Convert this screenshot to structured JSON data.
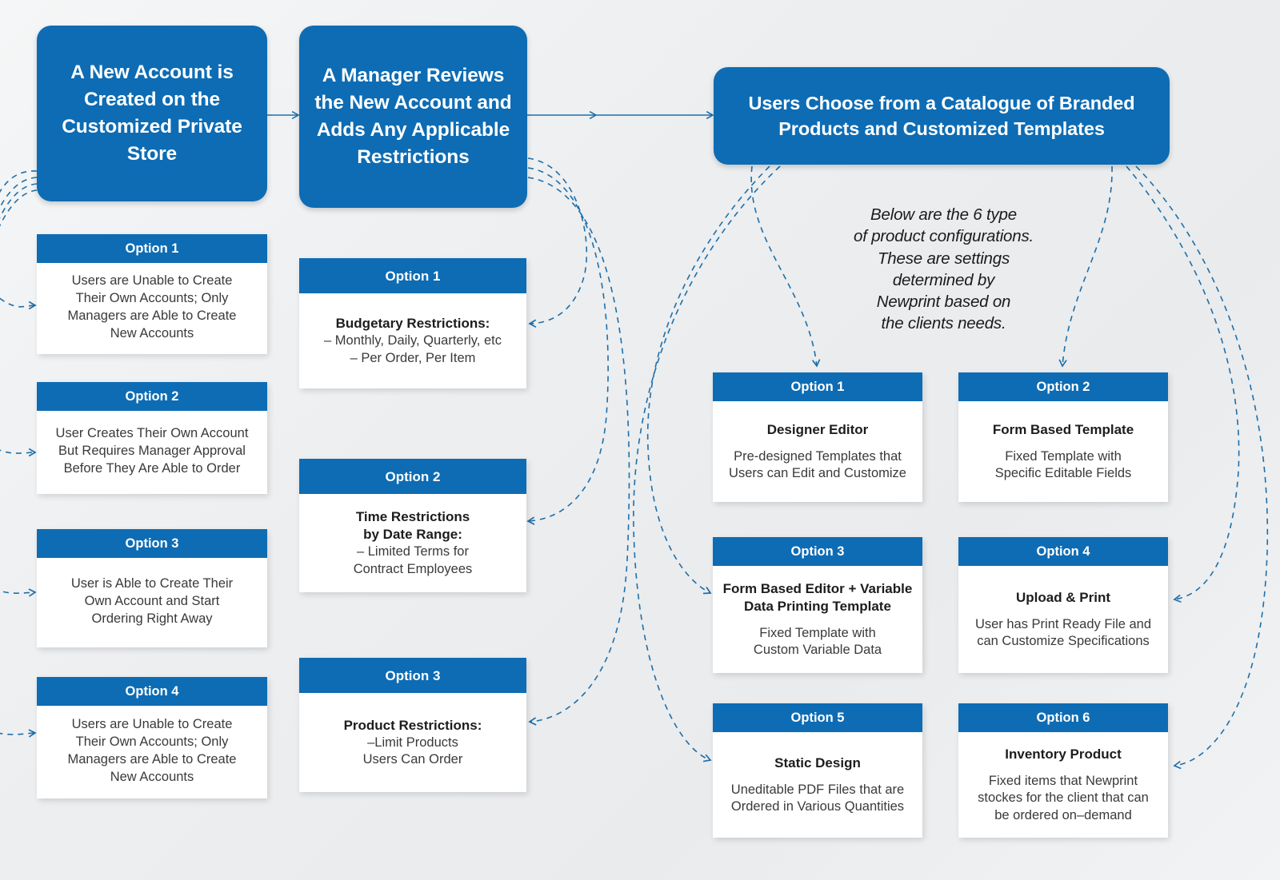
{
  "theme": {
    "brand_blue": "#0d6cb4",
    "connector_blue": "#1f6fa8",
    "card_bg": "#ffffff",
    "page_bg": "#eceef0"
  },
  "process_boxes": [
    {
      "id": "proc-1",
      "text": "A New Account\nis Created on\nthe Customized\nPrivate Store"
    },
    {
      "id": "proc-2",
      "text": "A Manager Reviews\nthe New Account and\nAdds Any Applicable\nRestrictions"
    },
    {
      "id": "proc-3",
      "text": "Users Choose from a Catalogue of Branded\nProducts and Customized Templates"
    }
  ],
  "note": "Below are the 6 type\nof product configurations.\nThese are settings\ndetermined by\nNewprint based on\nthe clients needs.",
  "account_options": [
    {
      "header": "Option 1",
      "title": "",
      "text": "Users are Unable to Create\nTheir Own Accounts; Only\nManagers are Able to Create\nNew Accounts"
    },
    {
      "header": "Option 2",
      "title": "",
      "text": "User Creates Their Own Account\nBut Requires Manager Approval\nBefore They Are Able to Order"
    },
    {
      "header": "Option 3",
      "title": "",
      "text": "User is Able to Create Their\nOwn Account and Start\nOrdering Right Away"
    },
    {
      "header": "Option 4",
      "title": "",
      "text": "Users are Unable to Create\nTheir Own Accounts; Only\nManagers are Able to Create\nNew Accounts"
    }
  ],
  "restriction_options": [
    {
      "header": "Option 1",
      "title": "Budgetary Restrictions:",
      "text": "– Monthly, Daily, Quarterly, etc\n– Per Order, Per Item"
    },
    {
      "header": "Option 2",
      "title": "Time Restrictions\nby Date Range:",
      "text": "– Limited Terms for\nContract Employees"
    },
    {
      "header": "Option 3",
      "title": "Product Restrictions:",
      "text": "–Limit Products\nUsers Can Order"
    }
  ],
  "product_options": [
    {
      "header": "Option 1",
      "title": "Designer Editor",
      "text": "Pre-designed Templates that\nUsers can Edit and Customize"
    },
    {
      "header": "Option 2",
      "title": "Form Based Template",
      "text": "Fixed Template with\nSpecific Editable Fields"
    },
    {
      "header": "Option 3",
      "title": "Form Based Editor + Variable\nData Printing Template",
      "text": "Fixed Template with\nCustom Variable Data"
    },
    {
      "header": "Option 4",
      "title": "Upload & Print",
      "text": "User has Print Ready File and\ncan Customize Specifications"
    },
    {
      "header": "Option 5",
      "title": "Static Design",
      "text": "Uneditable PDF Files that are\nOrdered in Various Quantities"
    },
    {
      "header": "Option 6",
      "title": "Inventory Product",
      "text": "Fixed items that Newprint\nstockes for the client that can\nbe ordered on–demand"
    }
  ]
}
